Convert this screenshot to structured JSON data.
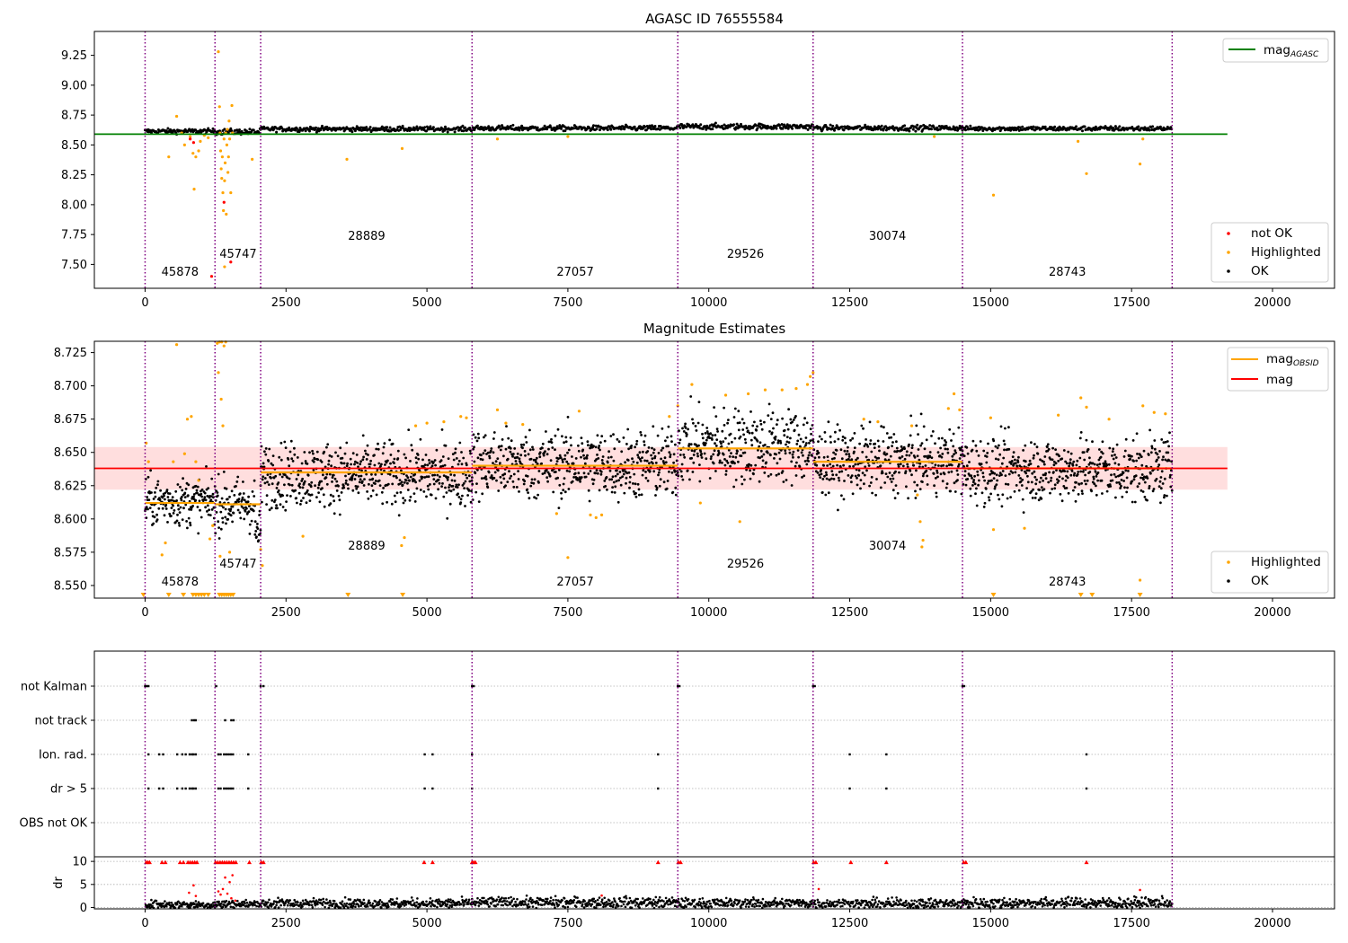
{
  "figure": {
    "agasc_id_title": "AGASC ID 76555584",
    "mag_title": "Magnitude Estimates"
  },
  "colors": {
    "ok": "#000000",
    "highlighted": "#ffa500",
    "not_ok": "#ff0000",
    "mag_agasc_line": "#008000",
    "mag_obsid_line": "#ffa500",
    "mag_line": "#ff0000",
    "mag_band": "#ffcccc",
    "obs_boundary": "#800080",
    "grid": "#b0b0b0"
  },
  "obs_boundaries": [
    0,
    1240,
    2050,
    5800,
    9450,
    11850,
    14500,
    18220
  ],
  "obsids": [
    {
      "label": "45878",
      "x": 620,
      "level": 0
    },
    {
      "label": "45747",
      "x": 1650,
      "level": 1
    },
    {
      "label": "28889",
      "x": 3930,
      "level": 2
    },
    {
      "label": "27057",
      "x": 7630,
      "level": 0
    },
    {
      "label": "29526",
      "x": 10650,
      "level": 1
    },
    {
      "label": "30074",
      "x": 13170,
      "level": 2
    },
    {
      "label": "28743",
      "x": 16360,
      "level": 0
    }
  ],
  "chart_data": [
    {
      "type": "scatter",
      "title": "AGASC ID 76555584",
      "xlim": [
        -900,
        21100
      ],
      "ylim": [
        7.3,
        9.45
      ],
      "x_ticks": [
        0,
        2500,
        5000,
        7500,
        10000,
        12500,
        15000,
        17500,
        20000
      ],
      "y_ticks": [
        7.5,
        7.75,
        8.0,
        8.25,
        8.5,
        8.75,
        9.0,
        9.25
      ],
      "y_tick_labels": [
        "7.50",
        "7.75",
        "8.00",
        "8.25",
        "8.50",
        "8.75",
        "9.00",
        "9.25"
      ],
      "mag_agasc": 8.59,
      "mag_agasc_xrange": [
        -900,
        19200
      ],
      "series": [
        {
          "name": "not OK",
          "color": "#ff0000"
        },
        {
          "name": "Highlighted",
          "color": "#ffa500"
        },
        {
          "name": "OK",
          "color": "#000000"
        }
      ],
      "line_legend": [
        {
          "name": "mag",
          "subscript": "AGASC",
          "color": "#008000"
        }
      ],
      "ok_segments": [
        {
          "x": [
            0,
            1240
          ],
          "level": 8.615,
          "spread": 0.01
        },
        {
          "x": [
            1240,
            2050
          ],
          "level": 8.61,
          "spread": 0.012
        },
        {
          "x": [
            2050,
            5800
          ],
          "level": 8.633,
          "spread": 0.01
        },
        {
          "x": [
            5800,
            9450
          ],
          "level": 8.64,
          "spread": 0.011
        },
        {
          "x": [
            9450,
            11850
          ],
          "level": 8.653,
          "spread": 0.012
        },
        {
          "x": [
            11850,
            14500
          ],
          "level": 8.642,
          "spread": 0.011
        },
        {
          "x": [
            14500,
            18220
          ],
          "level": 8.637,
          "spread": 0.01
        }
      ],
      "highlighted_points": [
        [
          560,
          8.74
        ],
        [
          650,
          8.6
        ],
        [
          420,
          8.4
        ],
        [
          700,
          8.5
        ],
        [
          800,
          8.57
        ],
        [
          850,
          8.43
        ],
        [
          870,
          8.13
        ],
        [
          900,
          8.4
        ],
        [
          950,
          8.45
        ],
        [
          980,
          8.53
        ],
        [
          1050,
          8.58
        ],
        [
          1120,
          8.56
        ],
        [
          1320,
          8.82
        ],
        [
          1330,
          8.6
        ],
        [
          1340,
          8.45
        ],
        [
          1350,
          8.3
        ],
        [
          1360,
          8.22
        ],
        [
          1370,
          8.4
        ],
        [
          1380,
          8.1
        ],
        [
          1390,
          7.95
        ],
        [
          1400,
          8.55
        ],
        [
          1410,
          8.2
        ],
        [
          1420,
          8.35
        ],
        [
          1430,
          8.6
        ],
        [
          1440,
          7.92
        ],
        [
          1450,
          8.5
        ],
        [
          1460,
          8.63
        ],
        [
          1470,
          8.27
        ],
        [
          1480,
          8.4
        ],
        [
          1490,
          8.7
        ],
        [
          1500,
          8.55
        ],
        [
          1520,
          8.1
        ],
        [
          1540,
          8.83
        ],
        [
          1550,
          8.6
        ],
        [
          1300,
          9.28
        ],
        [
          1410,
          7.48
        ],
        [
          1900,
          8.38
        ],
        [
          3580,
          8.38
        ],
        [
          4560,
          8.47
        ],
        [
          6250,
          8.55
        ],
        [
          7500,
          8.57
        ],
        [
          14000,
          8.57
        ],
        [
          15050,
          8.08
        ],
        [
          16550,
          8.53
        ],
        [
          16700,
          8.26
        ],
        [
          17650,
          8.34
        ],
        [
          17700,
          8.55
        ]
      ],
      "not_ok_points": [
        [
          800,
          8.55
        ],
        [
          860,
          8.52
        ],
        [
          1180,
          7.4
        ],
        [
          1400,
          8.02
        ],
        [
          1520,
          7.52
        ]
      ]
    },
    {
      "type": "scatter",
      "title": "Magnitude Estimates",
      "xlim": [
        -900,
        21100
      ],
      "ylim": [
        8.5405,
        8.7335
      ],
      "x_ticks": [
        0,
        2500,
        5000,
        7500,
        10000,
        12500,
        15000,
        17500,
        20000
      ],
      "y_ticks": [
        8.55,
        8.575,
        8.6,
        8.625,
        8.65,
        8.675,
        8.7,
        8.725
      ],
      "y_tick_labels": [
        "8.550",
        "8.575",
        "8.600",
        "8.625",
        "8.650",
        "8.675",
        "8.700",
        "8.725"
      ],
      "mag": 8.638,
      "mag_band": [
        8.622,
        8.654
      ],
      "mag_xrange": [
        -900,
        19200
      ],
      "mag_obsid_segments": [
        {
          "x": [
            0,
            1240
          ],
          "y": 8.612
        },
        {
          "x": [
            1240,
            2050
          ],
          "y": 8.611
        },
        {
          "x": [
            2050,
            5800
          ],
          "y": 8.635
        },
        {
          "x": [
            5800,
            9450
          ],
          "y": 8.64
        },
        {
          "x": [
            9450,
            11850
          ],
          "y": 8.653
        },
        {
          "x": [
            11850,
            14500
          ],
          "y": 8.643
        },
        {
          "x": [
            14500,
            18220
          ],
          "y": 8.638
        }
      ],
      "series": [
        {
          "name": "Highlighted",
          "color": "#ffa500"
        },
        {
          "name": "OK",
          "color": "#000000"
        }
      ],
      "line_legend": [
        {
          "name": "mag",
          "subscript": "OBSID",
          "color": "#ffa500"
        },
        {
          "name": "mag",
          "subscript": "",
          "color": "#ff0000"
        }
      ],
      "ok_segments": [
        {
          "x": [
            0,
            1240
          ],
          "level": 8.613,
          "spread": 0.009
        },
        {
          "x": [
            1240,
            1950
          ],
          "level": 8.611,
          "spread": 0.01
        },
        {
          "x": [
            1950,
            2050
          ],
          "level": 8.59,
          "spread": 0.008
        },
        {
          "x": [
            2050,
            5800
          ],
          "level": 8.633,
          "spread": 0.012
        },
        {
          "x": [
            5800,
            9450
          ],
          "level": 8.641,
          "spread": 0.013
        },
        {
          "x": [
            9450,
            11850
          ],
          "level": 8.655,
          "spread": 0.014
        },
        {
          "x": [
            11850,
            14500
          ],
          "level": 8.643,
          "spread": 0.012
        },
        {
          "x": [
            14500,
            18220
          ],
          "level": 8.637,
          "spread": 0.012
        }
      ],
      "highlighted_points": [
        [
          20,
          8.657
        ],
        [
          60,
          8.643
        ],
        [
          300,
          8.573
        ],
        [
          360,
          8.582
        ],
        [
          500,
          8.643
        ],
        [
          560,
          8.731
        ],
        [
          700,
          8.649
        ],
        [
          750,
          8.675
        ],
        [
          820,
          8.677
        ],
        [
          900,
          8.643
        ],
        [
          950,
          8.629
        ],
        [
          1150,
          8.585
        ],
        [
          1200,
          8.595
        ],
        [
          1280,
          8.732
        ],
        [
          1320,
          8.733
        ],
        [
          1360,
          8.733
        ],
        [
          1400,
          8.73
        ],
        [
          1430,
          8.733
        ],
        [
          1300,
          8.71
        ],
        [
          1350,
          8.69
        ],
        [
          1380,
          8.67
        ],
        [
          1330,
          8.572
        ],
        [
          1500,
          8.575
        ],
        [
          2050,
          8.577
        ],
        [
          2080,
          8.565
        ],
        [
          2800,
          8.587
        ],
        [
          4550,
          8.58
        ],
        [
          4600,
          8.586
        ],
        [
          4800,
          8.67
        ],
        [
          5000,
          8.672
        ],
        [
          5300,
          8.673
        ],
        [
          5600,
          8.677
        ],
        [
          5700,
          8.676
        ],
        [
          6250,
          8.682
        ],
        [
          6400,
          8.672
        ],
        [
          6700,
          8.671
        ],
        [
          7300,
          8.604
        ],
        [
          7500,
          8.571
        ],
        [
          7700,
          8.681
        ],
        [
          7900,
          8.603
        ],
        [
          8000,
          8.601
        ],
        [
          8100,
          8.603
        ],
        [
          9300,
          8.677
        ],
        [
          9450,
          8.685
        ],
        [
          9700,
          8.701
        ],
        [
          9850,
          8.612
        ],
        [
          10300,
          8.693
        ],
        [
          10550,
          8.598
        ],
        [
          10700,
          8.694
        ],
        [
          11000,
          8.697
        ],
        [
          11300,
          8.697
        ],
        [
          11550,
          8.698
        ],
        [
          11750,
          8.701
        ],
        [
          11800,
          8.707
        ],
        [
          11850,
          8.71
        ],
        [
          12750,
          8.675
        ],
        [
          13000,
          8.673
        ],
        [
          13600,
          8.67
        ],
        [
          13700,
          8.618
        ],
        [
          13750,
          8.598
        ],
        [
          13800,
          8.584
        ],
        [
          13780,
          8.579
        ],
        [
          14250,
          8.683
        ],
        [
          14350,
          8.694
        ],
        [
          14450,
          8.682
        ],
        [
          15000,
          8.676
        ],
        [
          15050,
          8.592
        ],
        [
          15600,
          8.593
        ],
        [
          16200,
          8.678
        ],
        [
          16600,
          8.691
        ],
        [
          16700,
          8.684
        ],
        [
          17100,
          8.675
        ],
        [
          17650,
          8.554
        ],
        [
          17700,
          8.685
        ],
        [
          17900,
          8.68
        ],
        [
          18100,
          8.679
        ]
      ],
      "below_axis_markers": [
        -30,
        420,
        680,
        850,
        900,
        950,
        1000,
        1050,
        1120,
        1320,
        1360,
        1400,
        1440,
        1480,
        1520,
        1560,
        3600,
        4570,
        15050,
        16600,
        16800,
        17650
      ]
    },
    {
      "type": "scatter",
      "title": "",
      "xlim": [
        -900,
        21100
      ],
      "x_ticks": [
        0,
        2500,
        5000,
        7500,
        10000,
        12500,
        15000,
        17500,
        20000
      ],
      "flag_categories": [
        "not Kalman",
        "not track",
        "Ion. rad.",
        "dr > 5",
        "OBS not OK"
      ],
      "flag_points": {
        "not Kalman": [
          0,
          30,
          60,
          1260,
          2050,
          2100,
          5800,
          5830,
          9450,
          9480,
          11850,
          11880,
          14500,
          14530
        ],
        "not track": [
          830,
          870,
          900,
          1420,
          1530,
          1570
        ],
        "Ion. rad.": [
          60,
          250,
          320,
          570,
          660,
          720,
          790,
          830,
          860,
          900,
          1300,
          1340,
          1400,
          1440,
          1480,
          1520,
          1560,
          1830,
          4960,
          5100,
          5800,
          9100,
          12500,
          13150,
          16700
        ],
        "dr > 5": [
          60,
          250,
          320,
          570,
          660,
          720,
          790,
          830,
          860,
          900,
          1300,
          1340,
          1400,
          1440,
          1480,
          1520,
          1560,
          1830,
          4960,
          5100,
          5800,
          9100,
          12500,
          13150,
          16700
        ],
        "OBS not OK": []
      },
      "dr_ylabel": "dr",
      "dr_ylim": [
        -0.3,
        11.0
      ],
      "dr_yticks": [
        0,
        5,
        10
      ],
      "dr_cap_points": [
        20,
        50,
        80,
        300,
        360,
        620,
        680,
        760,
        800,
        840,
        880,
        920,
        1250,
        1290,
        1330,
        1370,
        1410,
        1450,
        1490,
        1530,
        1570,
        1610,
        1850,
        2060,
        2100,
        4950,
        5100,
        5800,
        5830,
        5860,
        9100,
        9460,
        9500,
        11860,
        11900,
        12520,
        13150,
        14520,
        14560,
        16700
      ],
      "dr_high_points": [
        [
          780,
          3.2
        ],
        [
          860,
          4.8
        ],
        [
          900,
          2.5
        ],
        [
          1300,
          3.5
        ],
        [
          1340,
          2.8
        ],
        [
          1380,
          4.0
        ],
        [
          1420,
          6.5
        ],
        [
          1460,
          3.0
        ],
        [
          1500,
          5.5
        ],
        [
          1530,
          2.0
        ],
        [
          1550,
          7.0
        ],
        [
          1600,
          1.5
        ],
        [
          11950,
          4.0
        ],
        [
          17650,
          3.8
        ],
        [
          8100,
          2.6
        ]
      ],
      "dr_ok_segments": [
        {
          "x": [
            0,
            1240
          ],
          "level": 0.6,
          "spread": 0.45
        },
        {
          "x": [
            1240,
            2050
          ],
          "level": 0.7,
          "spread": 0.5
        },
        {
          "x": [
            2050,
            5800
          ],
          "level": 0.85,
          "spread": 0.55
        },
        {
          "x": [
            5800,
            9450
          ],
          "level": 1.05,
          "spread": 0.6
        },
        {
          "x": [
            9450,
            11850
          ],
          "level": 0.9,
          "spread": 0.55
        },
        {
          "x": [
            11850,
            14500
          ],
          "level": 0.8,
          "spread": 0.55
        },
        {
          "x": [
            14500,
            18220
          ],
          "level": 0.95,
          "spread": 0.6
        }
      ]
    }
  ]
}
